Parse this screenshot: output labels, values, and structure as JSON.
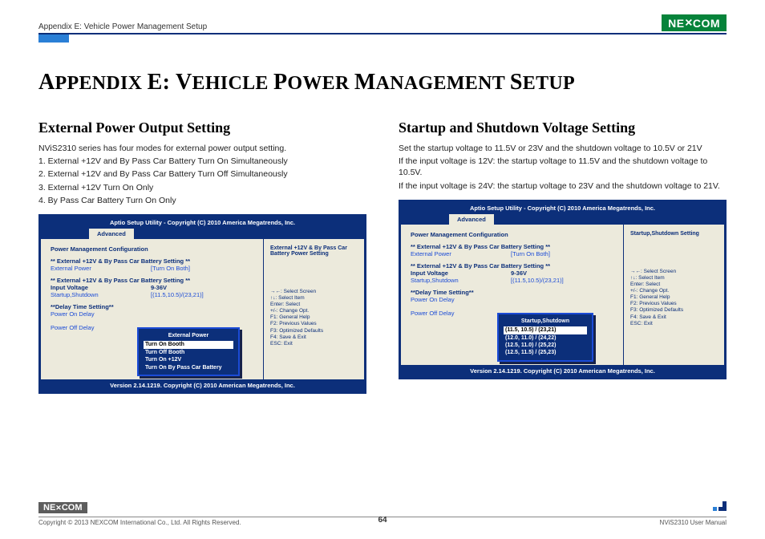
{
  "header": {
    "breadcrumb": "Appendix E: Vehicle Power Management Setup",
    "logo": "NEXCOM"
  },
  "title_parts": {
    "p1": "A",
    "p2": "PPENDIX ",
    "p3": "E: V",
    "p4": "EHICLE ",
    "p5": "P",
    "p6": "OWER ",
    "p7": "M",
    "p8": "ANAGEMENT ",
    "p9": "S",
    "p10": "ETUP"
  },
  "left": {
    "heading": "External Power Output Setting",
    "intro": "NViS2310 series has four modes for external power output setting.",
    "l1": "1. External +12V and By Pass Car Battery Turn On Simultaneously",
    "l2": "2. External +12V and By Pass Car Battery Turn Off Simultaneously",
    "l3": "3. External +12V Turn On Only",
    "l4": "4. By Pass Car Battery Turn On Only"
  },
  "right": {
    "heading": "Startup and Shutdown Voltage Setting",
    "p1": "Set the startup voltage to 11.5V or 23V and the shutdown voltage to 10.5V or 21V",
    "p2": "If the input voltage is 12V: the startup voltage to 11.5V and the shutdown voltage to 10.5V.",
    "p3": "If the input voltage is 24V: the startup voltage to 23V and the shutdown voltage to 21V."
  },
  "bios": {
    "hdr": "Aptio Setup Utility - Copyright (C) 2010 America Megatrends, Inc.",
    "tab": "Advanced",
    "cfg": "Power Management Configuration",
    "sect1": "** External +12V & By Pass Car Battery Setting **",
    "extpower_lbl": "External Power",
    "extpower_val": "[Turn On Both]",
    "sect2": "** External +12V & By Pass Car Battery Setting **",
    "inputv_lbl": "Input Voltage",
    "inputv_val": "9-36V",
    "startsd_lbl": "Startup,Shutdown",
    "startsd_val": "[(11.5,10.5)/(23,21)]",
    "delay": "**Delay Time Setting**",
    "pon": "Power On Delay",
    "poff": "Power Off Delay",
    "help_left": "External +12V & By Pass Car Battery Power Setting",
    "help_right": "Startup,Shutdown Setting",
    "keys": {
      "k1": "→←: Select Screen",
      "k2": "↑↓: Select Item",
      "k3": "Enter: Select",
      "k4": "+/-: Change Opt.",
      "k5": "F1: General Help",
      "k6": "F2: Previous Values",
      "k7": "F3: Optimized Defaults",
      "k8": "F4: Save & Exit",
      "k9": "ESC: Exit"
    },
    "ftr": "Version 2.14.1219. Copyright (C) 2010 American Megatrends, Inc."
  },
  "popup_left": {
    "title": "External Power",
    "o1": "Turn On Booth",
    "o2": "Turn Off Booth",
    "o3": "Turn On +12V",
    "o4": "Turn On By Pass Car Battery"
  },
  "popup_right": {
    "title": "Startup,Shutdown",
    "o1": "(11.5, 10.5) / (23,21)",
    "o2": "(12.0, 11.0) / (24,22)",
    "o3": "(12.5, 11.0) / (25,22)",
    "o4": "(12.5, 11.5) / (25,23)"
  },
  "footer": {
    "logo": "NEXCOM",
    "copyright": "Copyright © 2013 NEXCOM International Co., Ltd. All Rights Reserved.",
    "page": "64",
    "doc": "NViS2310 User Manual"
  }
}
